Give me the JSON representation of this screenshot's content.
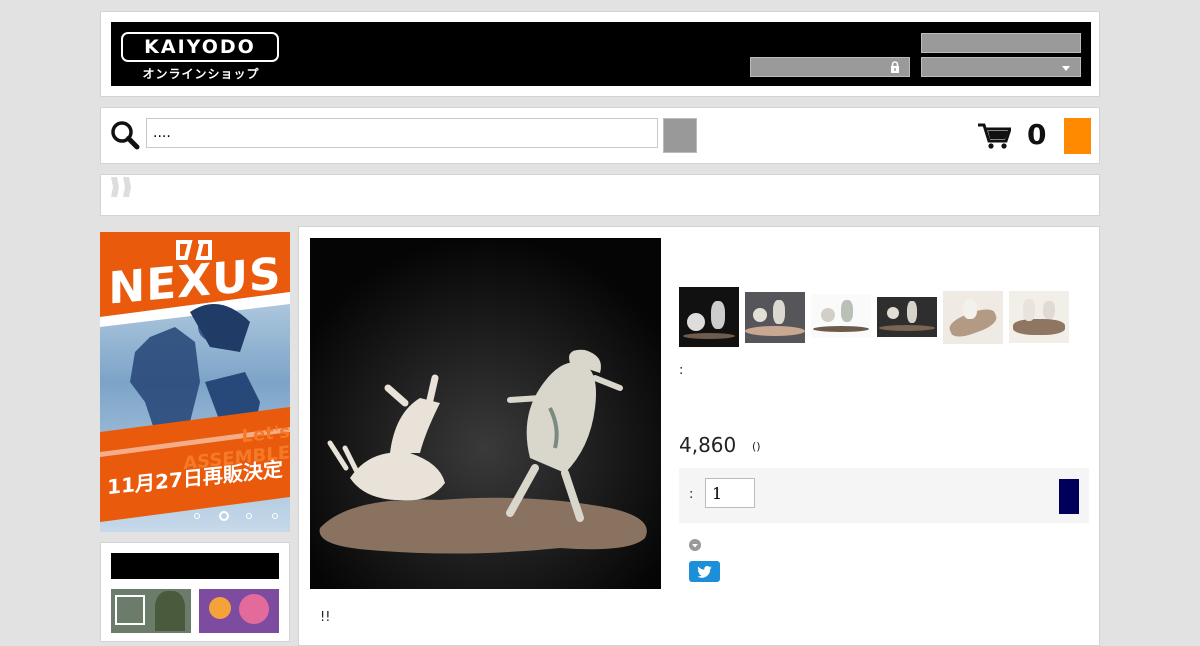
{
  "header": {
    "logo_text": "KAIYODO",
    "logo_subtitle": "オンラインショップ"
  },
  "search": {
    "query": "....",
    "cart_count": "0"
  },
  "banner": {
    "brand": "NEXUS",
    "slogan": "Let's ASSEMBLE",
    "restock_notice": "11月27日再販決定"
  },
  "product": {
    "spec_label": ":",
    "price": "4,860",
    "price_suffix": "()",
    "quantity_label": ":",
    "quantity_value": "1",
    "description_start": "!!"
  },
  "colors": {
    "cart_button": "#ff8a00",
    "buy_button": "#00005a",
    "twitter": "#1d8ed8"
  }
}
